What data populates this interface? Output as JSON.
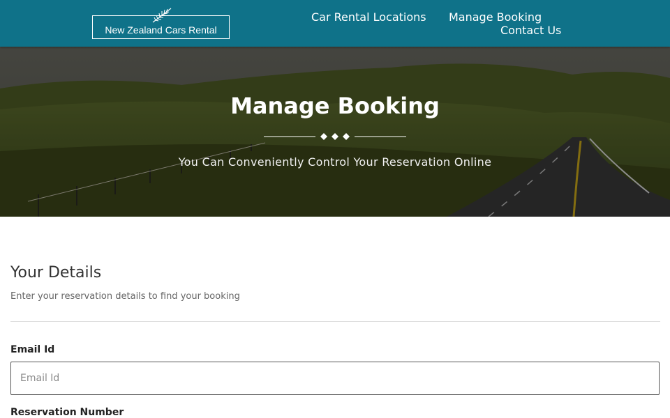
{
  "header": {
    "logo_text": "New Zealand Cars Rental",
    "nav": {
      "locations": "Car Rental Locations",
      "manage": "Manage Booking",
      "contact": "Contact Us"
    }
  },
  "hero": {
    "title": "Manage Booking",
    "subtitle": "You Can Conveniently Control Your Reservation Online"
  },
  "form": {
    "section_title": "Your Details",
    "section_desc": "Enter your reservation details to find your booking",
    "email_label": "Email Id",
    "email_placeholder": "Email Id",
    "email_value": "",
    "reservation_label": "Reservation Number"
  },
  "icons": {
    "logo": "fern-icon",
    "divider": "diamond-divider"
  },
  "colors": {
    "header_bg": "#0f7289",
    "text_white": "#ffffff"
  }
}
